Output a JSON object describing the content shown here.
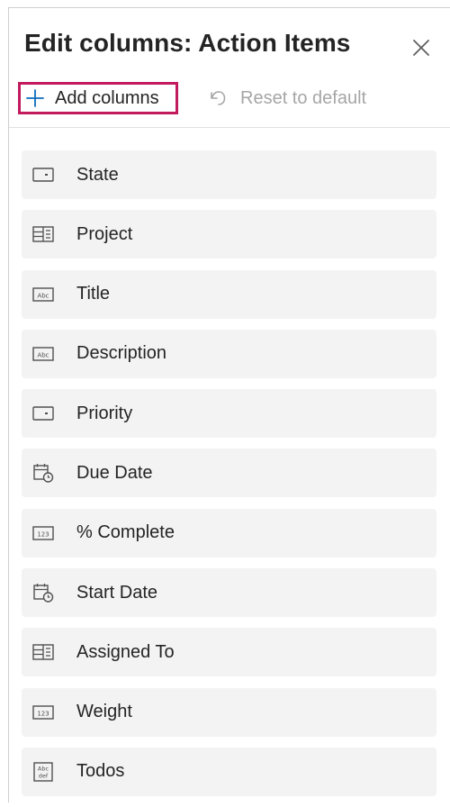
{
  "dialog": {
    "title": "Edit columns: Action Items",
    "close_icon": "close-icon"
  },
  "toolbar": {
    "add_label": "Add columns",
    "add_icon": "plus-icon",
    "reset_label": "Reset to default",
    "reset_icon": "undo-icon"
  },
  "colors": {
    "highlight": "#c3195d",
    "row_bg": "#f3f3f3",
    "disabled_text": "#a6a6a6"
  },
  "columns": [
    {
      "label": "State",
      "icon": "choice-icon"
    },
    {
      "label": "Project",
      "icon": "lookup-icon"
    },
    {
      "label": "Title",
      "icon": "text-icon"
    },
    {
      "label": "Description",
      "icon": "text-icon"
    },
    {
      "label": "Priority",
      "icon": "choice-icon"
    },
    {
      "label": "Due Date",
      "icon": "date-icon"
    },
    {
      "label": "% Complete",
      "icon": "number-icon"
    },
    {
      "label": "Start Date",
      "icon": "date-icon"
    },
    {
      "label": "Assigned To",
      "icon": "lookup-icon"
    },
    {
      "label": "Weight",
      "icon": "number-icon"
    },
    {
      "label": "Todos",
      "icon": "multiline-text-icon"
    }
  ]
}
